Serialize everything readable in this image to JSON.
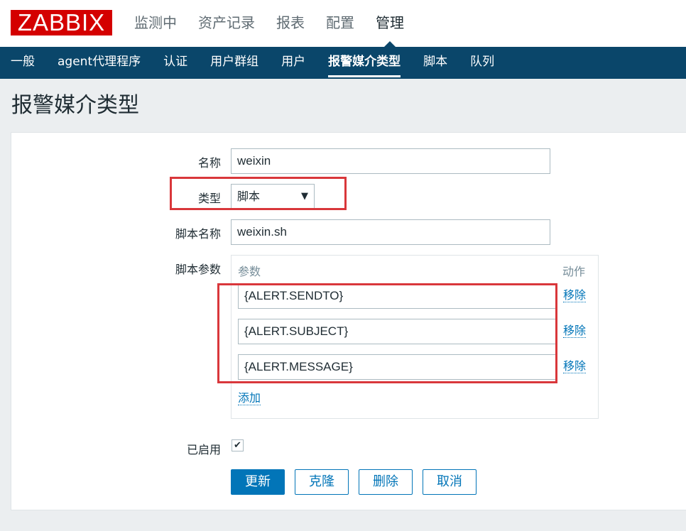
{
  "header": {
    "logo": "ZABBIX",
    "menu": [
      {
        "label": "监测中"
      },
      {
        "label": "资产记录"
      },
      {
        "label": "报表"
      },
      {
        "label": "配置"
      },
      {
        "label": "管理"
      }
    ]
  },
  "subnav": {
    "items": [
      {
        "label": "一般"
      },
      {
        "label": "agent代理程序"
      },
      {
        "label": "认证"
      },
      {
        "label": "用户群组"
      },
      {
        "label": "用户"
      },
      {
        "label": "报警媒介类型"
      },
      {
        "label": "脚本"
      },
      {
        "label": "队列"
      }
    ]
  },
  "page": {
    "title": "报警媒介类型"
  },
  "form": {
    "name_label": "名称",
    "name_value": "weixin",
    "type_label": "类型",
    "type_value": "脚本",
    "script_name_label": "脚本名称",
    "script_name_value": "weixin.sh",
    "script_params_label": "脚本参数",
    "params_header": "参数",
    "actions_header": "动作",
    "params": [
      {
        "value": "{ALERT.SENDTO}",
        "remove": "移除"
      },
      {
        "value": "{ALERT.SUBJECT}",
        "remove": "移除"
      },
      {
        "value": "{ALERT.MESSAGE}",
        "remove": "移除"
      }
    ],
    "add_label": "添加",
    "enabled_label": "已启用",
    "enabled": true
  },
  "buttons": {
    "update": "更新",
    "clone": "克隆",
    "delete": "删除",
    "cancel": "取消"
  },
  "colors": {
    "brand": "#d40000",
    "nav": "#0a466a",
    "primary": "#0275b8",
    "highlight": "#d9373b"
  }
}
